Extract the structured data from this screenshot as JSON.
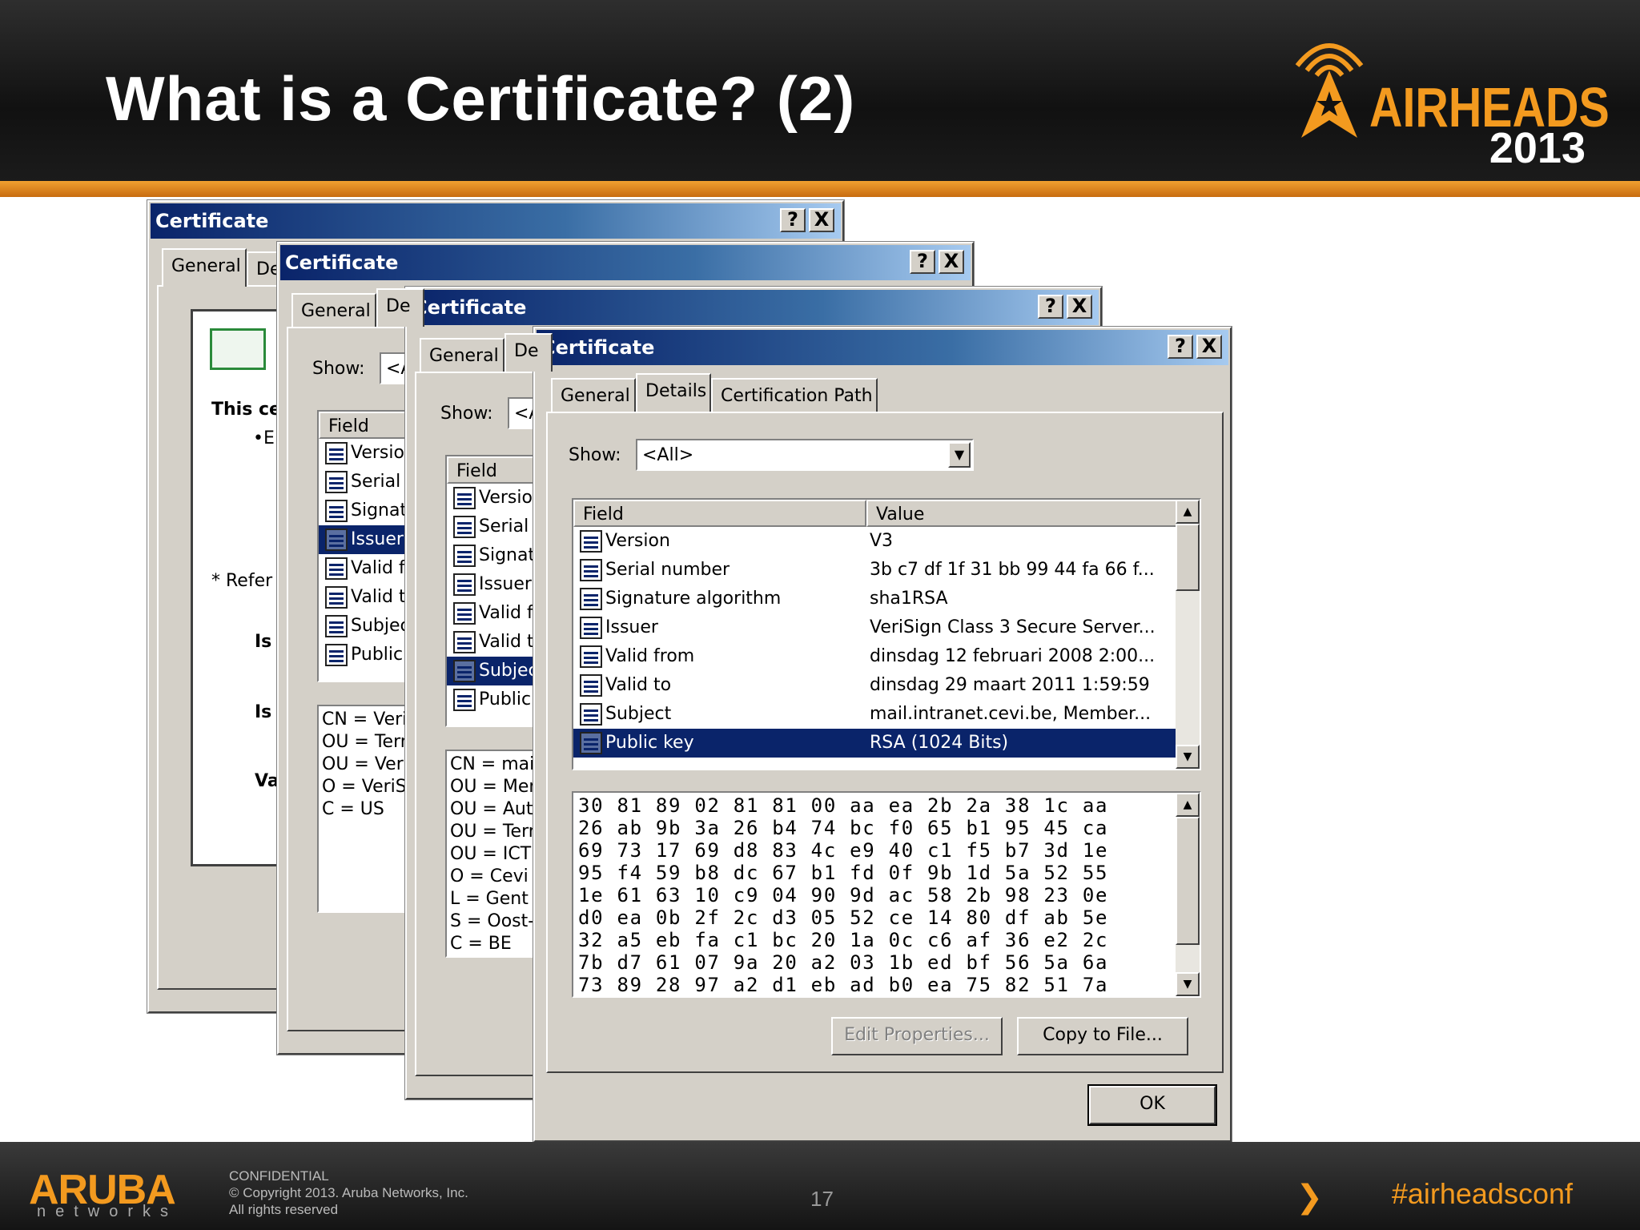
{
  "slide": {
    "title": "What is a Certificate? (2)",
    "logo_text": "AIRHEADS",
    "logo_year": "2013",
    "footer": {
      "brand": "ARUBA",
      "brand_sub": "networks",
      "confidential": "CONFIDENTIAL",
      "copyright": "© Copyright 2013. Aruba Networks, Inc.",
      "rights": "All rights reserved",
      "page_number": "17",
      "hashtag": "#airheadsconf"
    }
  },
  "dialogs": [
    {
      "title": "Certificate",
      "help_button": "?",
      "close_button": "X",
      "tabs": [
        "General",
        "De"
      ],
      "text_lines": [
        "This ce",
        "•E",
        "* Refer",
        "Is",
        "Is",
        "Va"
      ]
    },
    {
      "title": "Certificate",
      "help_button": "?",
      "close_button": "X",
      "tabs": [
        "General",
        "De"
      ],
      "show_label": "Show:",
      "show_value": "<A",
      "field_header": "Field",
      "fields": [
        "Versio",
        "Serial",
        "Signat",
        "Issuer",
        "Valid f",
        "Valid t",
        "Subjec",
        "Public"
      ],
      "selected_index": 3,
      "detail_lines": [
        "CN = VeriS",
        "OU = Term",
        "OU = VeriS",
        "O = VeriSig",
        "C = US"
      ]
    },
    {
      "title": "Certificate",
      "help_button": "?",
      "close_button": "X",
      "tabs": [
        "General",
        "De"
      ],
      "show_label": "Show:",
      "show_value": "<A",
      "field_header": "Field",
      "fields": [
        "Versio",
        "Serial",
        "Signat",
        "Issuer",
        "Valid fi",
        "Valid t",
        "Subjec",
        "Public"
      ],
      "selected_index": 6,
      "detail_lines": [
        "CN = mail.i",
        "OU = Mem",
        "OU = Auth",
        "OU = Term",
        "OU = ICT",
        "O = Cevi N",
        "L = Gent",
        "S = Oost-V",
        "C = BE"
      ]
    },
    {
      "title": "Certificate",
      "help_button": "?",
      "close_button": "X",
      "tabs": [
        "General",
        "Details",
        "Certification Path"
      ],
      "active_tab": "Details",
      "show_label": "Show:",
      "show_value": "<All>",
      "columns": [
        "Field",
        "Value"
      ],
      "rows": [
        {
          "field": "Version",
          "value": "V3"
        },
        {
          "field": "Serial number",
          "value": "3b c7 df 1f 31 bb 99 44 fa 66 f..."
        },
        {
          "field": "Signature algorithm",
          "value": "sha1RSA"
        },
        {
          "field": "Issuer",
          "value": "VeriSign Class 3 Secure Server..."
        },
        {
          "field": "Valid from",
          "value": "dinsdag 12 februari 2008 2:00..."
        },
        {
          "field": "Valid to",
          "value": "dinsdag 29 maart 2011 1:59:59"
        },
        {
          "field": "Subject",
          "value": "mail.intranet.cevi.be, Member..."
        },
        {
          "field": "Public key",
          "value": "RSA (1024 Bits)"
        }
      ],
      "selected_index": 7,
      "hex_lines": [
        "30 81 89 02 81 81 00 aa ea 2b 2a 38 1c aa",
        "26 ab 9b 3a 26 b4 74 bc f0 65 b1 95 45 ca",
        "69 73 17 69 d8 83 4c e9 40 c1 f5 b7 3d 1e",
        "95 f4 59 b8 dc 67 b1 fd 0f 9b 1d 5a 52 55",
        "1e 61 63 10 c9 04 90 9d ac 58 2b 98 23 0e",
        "d0 ea 0b 2f 2c d3 05 52 ce 14 80 df ab 5e",
        "32 a5 eb fa c1 bc 20 1a 0c c6 af 36 e2 2c",
        "7b d7 61 07 9a 20 a2 03 1b ed bf 56 5a 6a",
        "73 89 28 97 a2 d1 eb ad b0 ea 75 82 51 7a"
      ],
      "edit_button": "Edit Properties...",
      "copy_button": "Copy to File...",
      "ok_button": "OK"
    }
  ]
}
